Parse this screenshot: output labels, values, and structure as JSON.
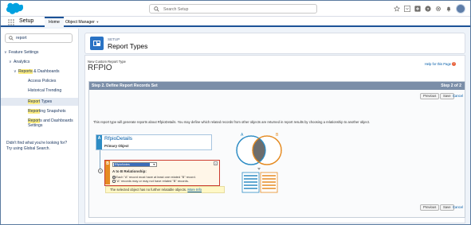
{
  "header": {
    "search_placeholder": "Search Setup",
    "icons": [
      "favorites-icon",
      "add-icon",
      "help-icon",
      "settings-icon",
      "notifications-icon",
      "avatar"
    ]
  },
  "appnav": {
    "app_name": "Setup",
    "tabs": [
      {
        "label": "Home",
        "active": true
      },
      {
        "label": "Object Manager",
        "active": false
      }
    ]
  },
  "sidebar": {
    "quickfind_value": "report",
    "tree": [
      {
        "label": "Feature Settings"
      },
      {
        "label": "Analytics"
      },
      {
        "label_hl": "Reports",
        "label_rest": " & Dashboards"
      },
      {
        "label": "Access Policies"
      },
      {
        "label": "Historical Trending"
      },
      {
        "label_hl": "Report",
        "label_rest": " Types"
      },
      {
        "label_hl": "Report",
        "label_rest": "ing Snapshots"
      },
      {
        "label_hl": "Report",
        "label_rest": "s and Dashboards Settings"
      }
    ],
    "hint_line1": "Didn't find what you're looking for?",
    "hint_line2": "Try using Global Search."
  },
  "page_header": {
    "eyebrow": "SETUP",
    "title": "Report Types"
  },
  "content": {
    "breadcrumb_label": "New Custom Report Type",
    "record_title": "RFPIO",
    "help_link": "Help for this Page",
    "step_title": "Step 2. Define Report Records Set",
    "step_number": "Step 2 of 2",
    "buttons": {
      "previous": "Previous",
      "save": "Save",
      "cancel": "Cancel"
    },
    "description": "This report type will generate reports about RfpioDetails. You may define which related records from other objects are returned in report results by choosing a relationship to another object.",
    "object_a": {
      "tag": "A",
      "name": "RfpioDetails",
      "subtitle": "Primary Object"
    },
    "object_b": {
      "tag": "B",
      "selected": "RfpioNotes",
      "relationship_label": "A to B Relationship:",
      "option1": "Each \"A\" record must have at least one related \"B\" record.",
      "option2": "\"A\" records may or may not have related \"B\" records.",
      "selected_option": 1
    },
    "note_text": "The selected object has no further relatable objects.",
    "note_link": "More Info",
    "venn": {
      "label_a": "A",
      "label_b": "B",
      "color_a": "#2d8cc4",
      "color_b": "#e58b22"
    }
  }
}
